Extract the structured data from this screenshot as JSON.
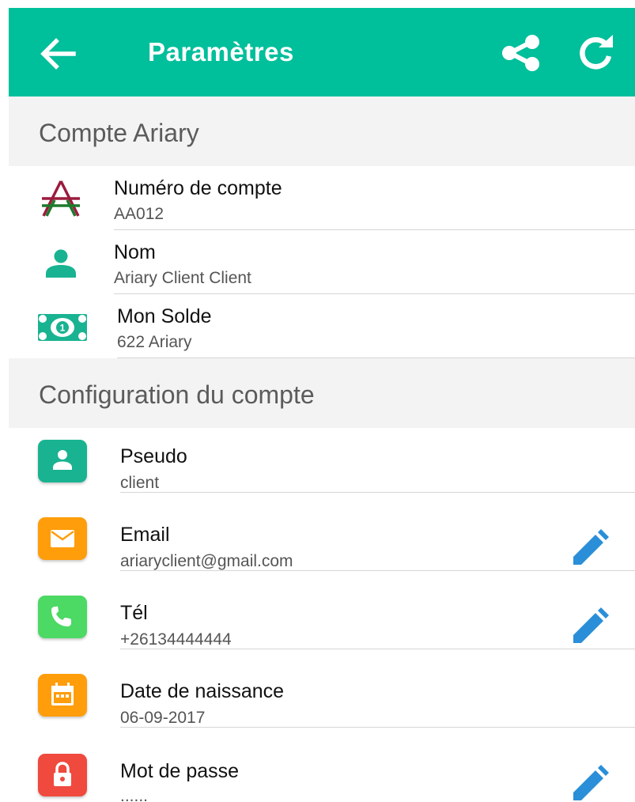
{
  "appbar": {
    "title": "Paramètres",
    "back_icon": "arrow-left-icon",
    "share_icon": "share-icon",
    "refresh_icon": "refresh-icon",
    "color": "#00bf9b"
  },
  "account": {
    "header": "Compte Ariary",
    "rows": [
      {
        "label": "Numéro de compte",
        "value": "AA012",
        "icon": "ariary-logo-icon"
      },
      {
        "label": "Nom",
        "value": "Ariary Client Client",
        "icon": "person-icon"
      },
      {
        "label": "Mon Solde",
        "value": "622 Ariary",
        "icon": "banknote-icon"
      }
    ]
  },
  "config": {
    "header": "Configuration du compte",
    "rows": [
      {
        "label": "Pseudo",
        "value": "client",
        "icon": "person-icon",
        "color": "#19b391",
        "editable": false
      },
      {
        "label": "Email",
        "value": "ariaryclient@gmail.com",
        "icon": "mail-icon",
        "color": "#ff9d0b",
        "editable": true
      },
      {
        "label": "Tél",
        "value": "+26134444444",
        "icon": "phone-icon",
        "color": "#4cd964",
        "editable": true
      },
      {
        "label": "Date de naissance",
        "value": "06-09-2017",
        "icon": "calendar-icon",
        "color": "#ff9d0b",
        "editable": false
      },
      {
        "label": "Mot de passe",
        "value": "......",
        "icon": "lock-icon",
        "color": "#f0493e",
        "editable": true
      }
    ]
  },
  "edit_icon": "pencil-icon",
  "edit_color": "#2a8fd8"
}
